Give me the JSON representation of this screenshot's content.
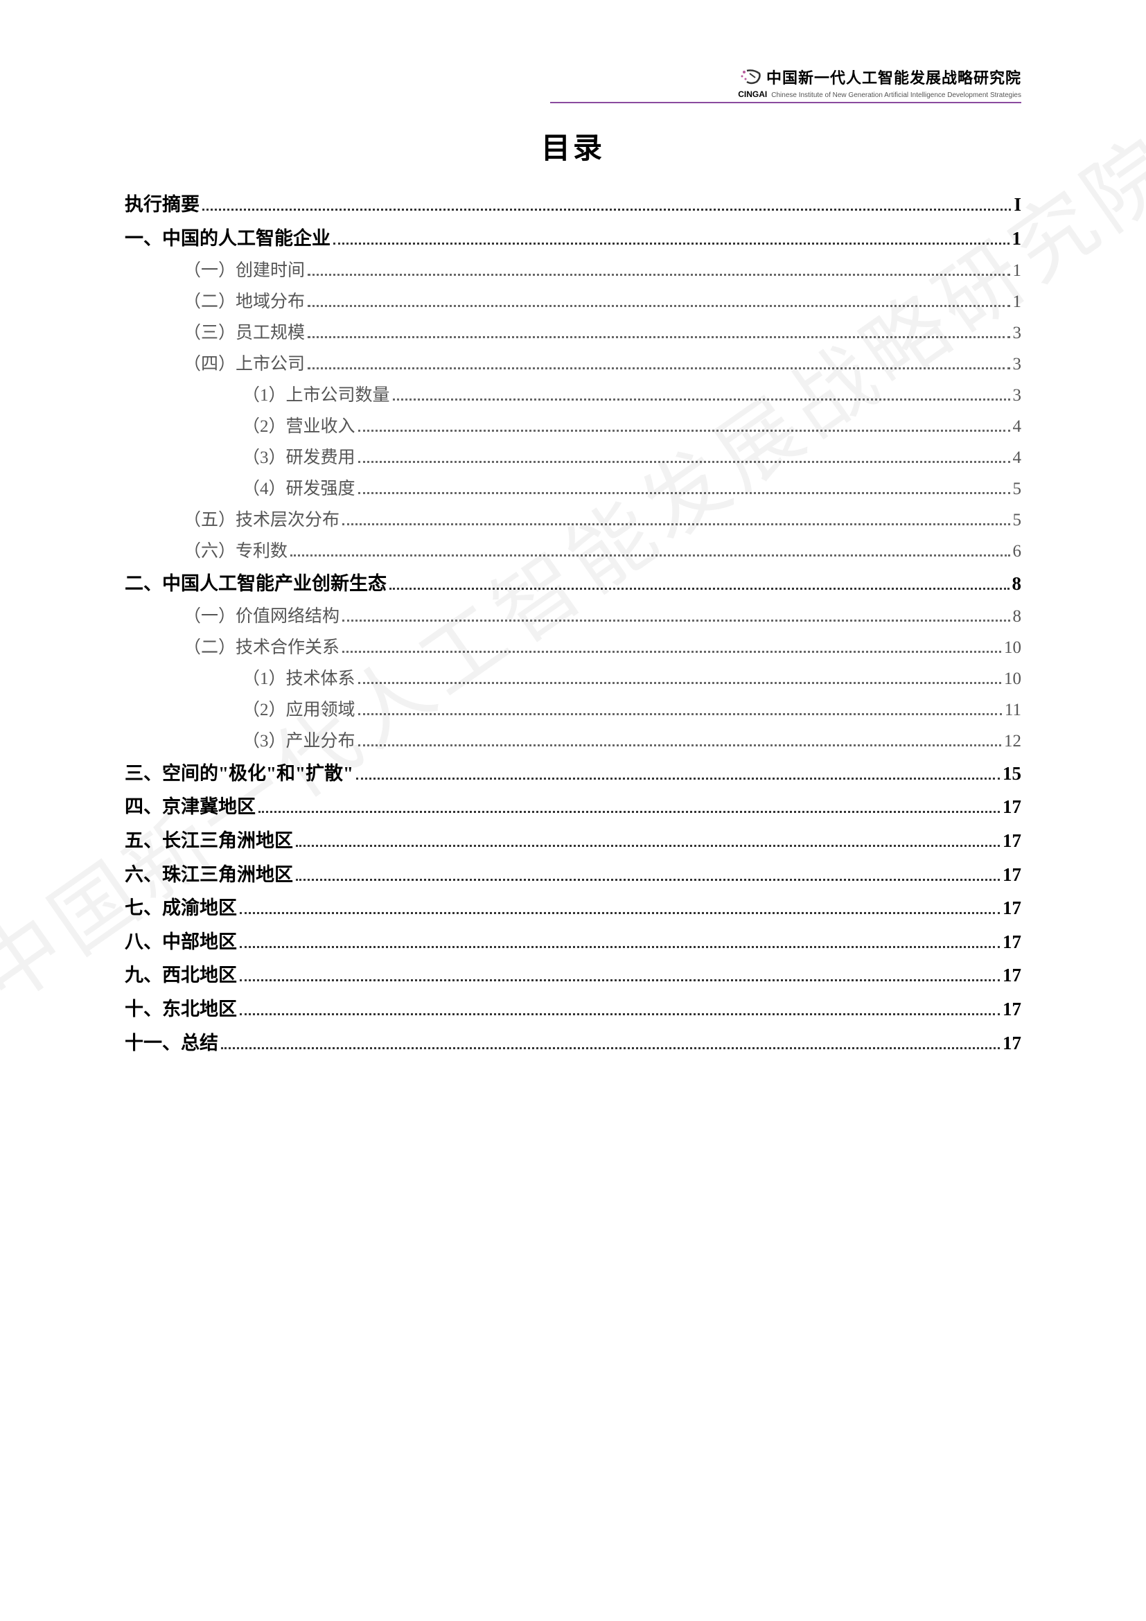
{
  "header": {
    "title_cn": "中国新一代人工智能发展战略研究院",
    "abbr": "CINGAI",
    "title_en": "Chinese Institute of New Generation Artificial Intelligence Development Strategies"
  },
  "toc": {
    "title": "目录",
    "entries": [
      {
        "level": 0,
        "label": "执行摘要",
        "page": "I"
      },
      {
        "level": 0,
        "label": "一、中国的人工智能企业",
        "page": "1"
      },
      {
        "level": 1,
        "label": "（一）创建时间",
        "page": "1"
      },
      {
        "level": 1,
        "label": "（二）地域分布",
        "page": "1"
      },
      {
        "level": 1,
        "label": "（三）员工规模",
        "page": "3"
      },
      {
        "level": 1,
        "label": "（四）上市公司",
        "page": "3"
      },
      {
        "level": 2,
        "label": "（1）上市公司数量",
        "page": "3"
      },
      {
        "level": 2,
        "label": "（2）营业收入",
        "page": "4"
      },
      {
        "level": 2,
        "label": "（3）研发费用",
        "page": "4"
      },
      {
        "level": 2,
        "label": "（4）研发强度",
        "page": "5"
      },
      {
        "level": 1,
        "label": "（五）技术层次分布",
        "page": "5"
      },
      {
        "level": 1,
        "label": "（六）专利数",
        "page": "6"
      },
      {
        "level": 0,
        "label": "二、中国人工智能产业创新生态",
        "page": "8"
      },
      {
        "level": 1,
        "label": "（一）价值网络结构",
        "page": "8"
      },
      {
        "level": 1,
        "label": "（二）技术合作关系",
        "page": "10"
      },
      {
        "level": 2,
        "label": "（1）技术体系",
        "page": "10"
      },
      {
        "level": 2,
        "label": "（2）应用领域",
        "page": "11"
      },
      {
        "level": 2,
        "label": "（3）产业分布",
        "page": "12"
      },
      {
        "level": 0,
        "label": "三、空间的\"极化\"和\"扩散\"",
        "page": "15"
      },
      {
        "level": 0,
        "label": "四、京津冀地区",
        "page": "17"
      },
      {
        "level": 0,
        "label": "五、长江三角洲地区",
        "page": "17"
      },
      {
        "level": 0,
        "label": "六、珠江三角洲地区",
        "page": "17"
      },
      {
        "level": 0,
        "label": "七、成渝地区",
        "page": "17"
      },
      {
        "level": 0,
        "label": "八、中部地区",
        "page": "17"
      },
      {
        "level": 0,
        "label": "九、西北地区",
        "page": "17"
      },
      {
        "level": 0,
        "label": "十、东北地区",
        "page": "17"
      },
      {
        "level": 0,
        "label": "十一、总结",
        "page": "17"
      }
    ]
  },
  "watermark": "中国新一代人工智能发展战略研究院"
}
